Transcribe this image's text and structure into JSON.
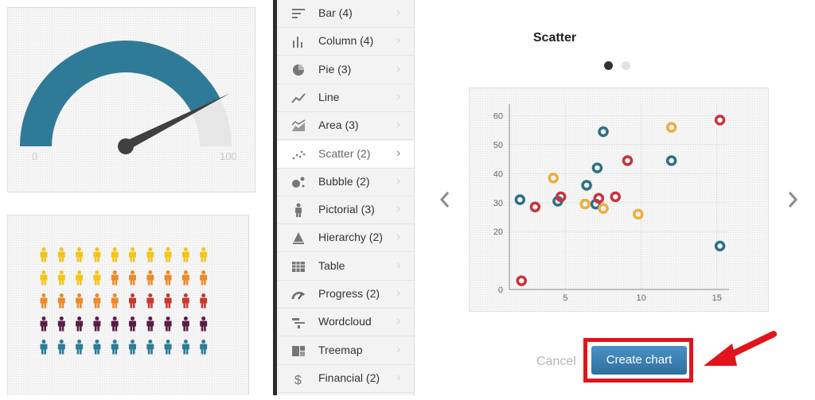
{
  "background": {
    "gauge": {
      "min_label": "0",
      "max_label": "100",
      "value": 85,
      "fill_color": "#2f7b97",
      "track_color": "#e6e6e6",
      "needle_color": "#404040"
    },
    "pictorial": {
      "rows": 5,
      "cols": 10,
      "row_colors": [
        [
          "#f2c51a",
          "#f2c51a",
          "#f2c51a",
          "#f2c51a",
          "#f2c51a",
          "#f2c51a",
          "#f2c51a",
          "#f2c51a",
          "#f2c51a",
          "#f2c51a"
        ],
        [
          "#f2c51a",
          "#f2c51a",
          "#f2c51a",
          "#f2c51a",
          "#eb8b2a",
          "#eb8b2a",
          "#eb8b2a",
          "#eb8b2a",
          "#eb8b2a",
          "#eb8b2a"
        ],
        [
          "#eb8b2a",
          "#eb8b2a",
          "#eb8b2a",
          "#eb8b2a",
          "#eb8b2a",
          "#c8392d",
          "#c8392d",
          "#c8392d",
          "#c8392d",
          "#c8392d"
        ],
        [
          "#5a1d45",
          "#5a1d45",
          "#5a1d45",
          "#5a1d45",
          "#5a1d45",
          "#5a1d45",
          "#5a1d45",
          "#5a1d45",
          "#5a1d45",
          "#5a1d45"
        ],
        [
          "#2b7d9a",
          "#2b7d9a",
          "#2b7d9a",
          "#2b7d9a",
          "#2b7d9a",
          "#2b7d9a",
          "#2b7d9a",
          "#2b7d9a",
          "#2b7d9a",
          "#2b7d9a"
        ]
      ]
    }
  },
  "chart_types": [
    {
      "label": "Bar (4)",
      "icon": "bar-chart-icon"
    },
    {
      "label": "Column (4)",
      "icon": "column-chart-icon"
    },
    {
      "label": "Pie (3)",
      "icon": "pie-chart-icon"
    },
    {
      "label": "Line",
      "icon": "line-chart-icon"
    },
    {
      "label": "Area (3)",
      "icon": "area-chart-icon"
    },
    {
      "label": "Scatter (2)",
      "icon": "scatter-chart-icon",
      "active": true
    },
    {
      "label": "Bubble (2)",
      "icon": "bubble-chart-icon"
    },
    {
      "label": "Pictorial (3)",
      "icon": "pictorial-chart-icon"
    },
    {
      "label": "Hierarchy (2)",
      "icon": "hierarchy-chart-icon"
    },
    {
      "label": "Table",
      "icon": "table-icon"
    },
    {
      "label": "Progress (2)",
      "icon": "progress-chart-icon"
    },
    {
      "label": "Wordcloud",
      "icon": "wordcloud-icon"
    },
    {
      "label": "Treemap",
      "icon": "treemap-icon"
    },
    {
      "label": "Financial (2)",
      "icon": "financial-chart-icon"
    }
  ],
  "chevron": "›",
  "preview": {
    "title": "Scatter",
    "page_count": 2,
    "active_page": 1,
    "prev_icon": "chevron-left-icon",
    "next_icon": "chevron-right-icon"
  },
  "buttons": {
    "cancel": "Cancel",
    "create": "Create chart"
  },
  "highlight": {
    "box_color": "#e0141a",
    "arrow_color": "#e0141a"
  },
  "chart_data": {
    "type": "scatter",
    "title": "",
    "xlabel": "",
    "ylabel": "",
    "xlim": [
      1.3,
      15.8
    ],
    "ylim": [
      0,
      64
    ],
    "x_ticks": [
      5,
      10,
      15
    ],
    "y_ticks": [
      0,
      20,
      30,
      40,
      50,
      60
    ],
    "grid": true,
    "legend": "none",
    "series": [
      {
        "color": "#2e6f88",
        "points": [
          [
            2,
            31
          ],
          [
            4.5,
            30.5
          ],
          [
            6.4,
            36
          ],
          [
            7,
            29.5
          ],
          [
            7.1,
            42
          ],
          [
            7.5,
            54.5
          ],
          [
            12,
            44.5
          ],
          [
            15.2,
            15
          ]
        ]
      },
      {
        "color": "#f0ad3c",
        "points": [
          [
            4.2,
            38.5
          ],
          [
            6.3,
            29.5
          ],
          [
            7.5,
            28
          ],
          [
            9.8,
            26
          ],
          [
            12,
            56
          ]
        ]
      },
      {
        "color": "#c8333b",
        "points": [
          [
            2.1,
            3
          ],
          [
            3,
            28.5
          ],
          [
            4.7,
            32
          ],
          [
            7.2,
            31.5
          ],
          [
            8.3,
            32
          ],
          [
            9.1,
            44.5
          ],
          [
            15.2,
            58.5
          ]
        ]
      }
    ]
  }
}
